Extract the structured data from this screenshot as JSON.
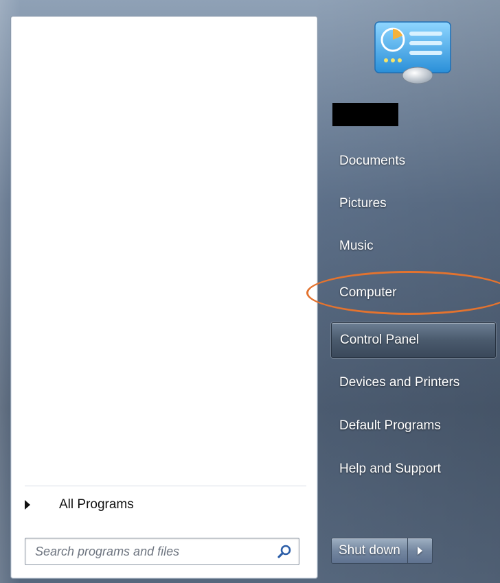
{
  "left_pane": {
    "all_programs_label": "All Programs",
    "search": {
      "placeholder": "Search programs and files",
      "value": ""
    }
  },
  "right_pane": {
    "user_picture_icon": "control-panel-picture-icon",
    "items": [
      {
        "label": "Documents"
      },
      {
        "label": "Pictures"
      },
      {
        "label": "Music"
      },
      {
        "label": "Computer",
        "annotated": true
      },
      {
        "label": "Control Panel",
        "highlighted": true
      },
      {
        "label": "Devices and Printers"
      },
      {
        "label": "Default Programs"
      },
      {
        "label": "Help and Support"
      }
    ]
  },
  "shutdown": {
    "label": "Shut down",
    "arrow_icon": "right-arrow-icon"
  },
  "colors": {
    "annotation": "#e3732f",
    "pane_background": "#4b5b70",
    "highlight": "#3a485a"
  }
}
